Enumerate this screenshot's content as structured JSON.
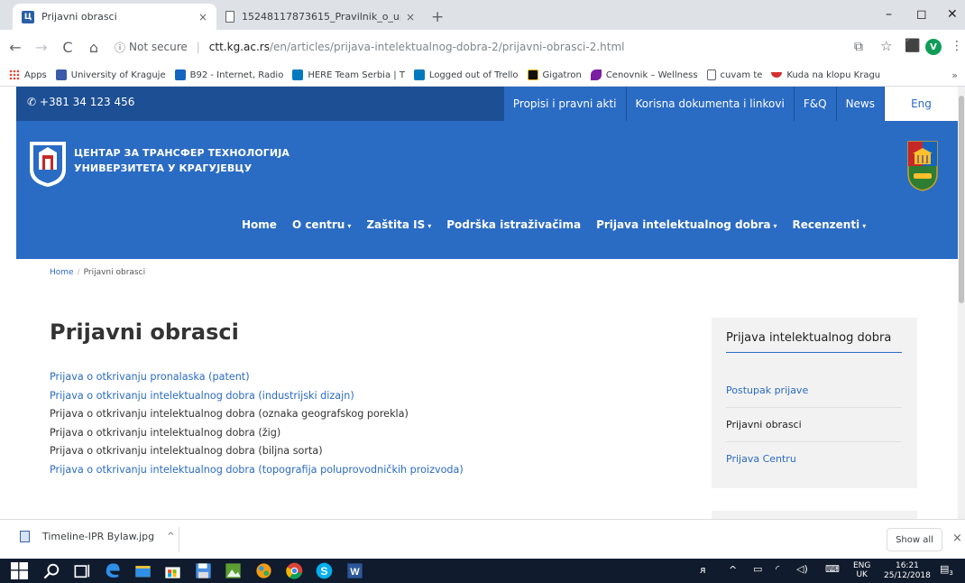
{
  "browser": {
    "tabs": [
      {
        "title": "Prijavni obrasci",
        "close": "×"
      },
      {
        "title": "15248117873615_Pravilnik_o_up",
        "close": "×"
      }
    ],
    "new_tab": "+",
    "window_controls": {
      "minimize": "–",
      "maximize": "◻",
      "close": "✕"
    },
    "nav": {
      "back": "←",
      "forward": "→",
      "reload": "C",
      "home": "⌂"
    },
    "address": {
      "security_icon": "ⓘ",
      "security_text": "Not secure",
      "separator": "|",
      "host": "ctt.kg.ac.rs",
      "path": "/en/articles/prijava-intelektualnog-dobra-2/prijavni-obrasci-2.html"
    },
    "toolbar_icons": {
      "translate": "⧉",
      "star": "☆",
      "pdf": "⬛",
      "menu": "⋮"
    },
    "profile_initial": "V",
    "bookmarks": [
      {
        "label": "Apps",
        "color": "#4285f4"
      },
      {
        "label": "University of Kraguje",
        "color": "#3b5ba9"
      },
      {
        "label": "B92 - Internet, Radio",
        "color": "#1565c0"
      },
      {
        "label": "HERE Team Serbia | T",
        "color": "#0079bf"
      },
      {
        "label": "Logged out of Trello",
        "color": "#0079bf"
      },
      {
        "label": "Gigatron",
        "color": "#111111"
      },
      {
        "label": "Cenovnik – Wellness",
        "color": "#7b1fa2"
      },
      {
        "label": "cuvam te",
        "color": "#ffffff"
      },
      {
        "label": "Kuda na klopu Kragu",
        "color": "#d32f2f"
      }
    ],
    "bookmarks_more": "»"
  },
  "site": {
    "phone": "+381 34 123 456",
    "phone_icon": "phone-icon",
    "top_links": [
      "Propisi i pravni akti",
      "Korisna dokumenta i linkovi",
      "F&Q",
      "News"
    ],
    "language": "Eng",
    "center_name_line1": "ЦЕНТАР ЗА ТРАНСФЕР ТЕХНОЛОГИЈА",
    "center_name_line2": "УНИВЕРЗИТЕТА У КРАГУЈЕВЦУ",
    "main_nav": [
      {
        "label": "Home",
        "caret": ""
      },
      {
        "label": "O centru",
        "caret": "▾"
      },
      {
        "label": "Zaštita IS",
        "caret": "▾"
      },
      {
        "label": "Podrška istraživačima",
        "caret": ""
      },
      {
        "label": "Prijava intelektualnog dobra",
        "caret": "▾"
      },
      {
        "label": "Recenzenti",
        "caret": "▾"
      }
    ],
    "brand_color": "#2a6bc4",
    "topbar_color": "#1c4f94"
  },
  "breadcrumb": {
    "home": "Home",
    "sep": "/",
    "current": "Prijavni obrasci"
  },
  "page": {
    "title": "Prijavni obrasci",
    "forms": [
      {
        "text": "Prijava o otkrivanju pronalaska (patent)",
        "link": true
      },
      {
        "text": "Prijava o otkrivanju intelektualnog dobra (industrijski dizajn)",
        "link": true
      },
      {
        "text": "Prijava o otkrivanju intelektualnog dobra (oznaka geografskog porekla)",
        "link": false
      },
      {
        "text": "Prijava o otkrivanju intelektualnog dobra (žig)",
        "link": false
      },
      {
        "text": "Prijava o otkrivanju intelektualnog dobra (biljna sorta)",
        "link": false
      },
      {
        "text": "Prijava o otkrivanju intelektualnog dobra (topografija poluprovodničkih proizvoda)",
        "link": true
      }
    ]
  },
  "sidebar": {
    "heading": "Prijava intelektualnog dobra",
    "items": [
      {
        "label": "Postupak prijave",
        "current": false
      },
      {
        "label": "Prijavni obrasci",
        "current": true
      },
      {
        "label": "Prijava Centru",
        "current": false
      }
    ]
  },
  "downloads": {
    "file": "Timeline-IPR Bylaw.jpg",
    "caret": "^",
    "show_all": "Show all",
    "close": "×"
  },
  "taskbar": {
    "lang_top": "ENG",
    "lang_bottom": "UK",
    "time": "16:21",
    "date": "25/12/2018",
    "notification_count": "3"
  }
}
